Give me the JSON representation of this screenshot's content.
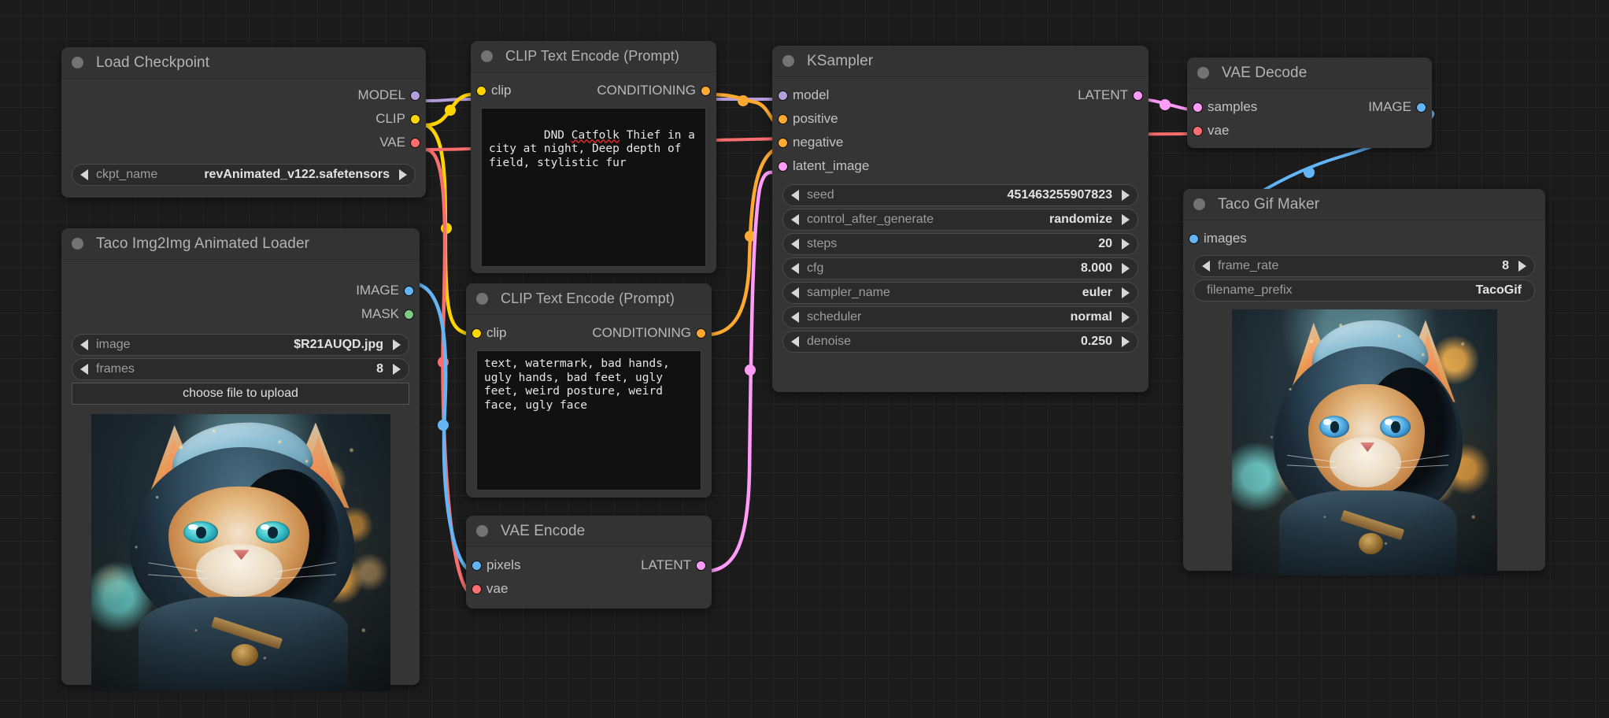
{
  "app": {
    "canvas_background": "#1b1b1b",
    "node_background": "#353535"
  },
  "socket_colors": {
    "MODEL": "#b39ddb",
    "CLIP": "#ffd500",
    "VAE": "#ff6e6e",
    "CONDITIONING": "#ffa931",
    "LATENT": "#ff9cf9",
    "IMAGE": "#64b5f6",
    "MASK": "#81c784"
  },
  "nodes": {
    "load_checkpoint": {
      "title": "Load Checkpoint",
      "outputs": [
        {
          "label": "MODEL",
          "type": "MODEL"
        },
        {
          "label": "CLIP",
          "type": "CLIP"
        },
        {
          "label": "VAE",
          "type": "VAE"
        }
      ],
      "widgets": [
        {
          "name": "ckpt_name",
          "value": "revAnimated_v122.safetensors"
        }
      ]
    },
    "taco_loader": {
      "title": "Taco Img2Img Animated Loader",
      "outputs": [
        {
          "label": "IMAGE",
          "type": "IMAGE"
        },
        {
          "label": "MASK",
          "type": "MASK"
        }
      ],
      "widgets": [
        {
          "name": "image",
          "value": "$R21AUQD.jpg"
        },
        {
          "name": "frames",
          "value": "8"
        }
      ],
      "upload_button": "choose file to upload"
    },
    "clip_positive": {
      "title": "CLIP Text Encode (Prompt)",
      "input": {
        "label": "clip",
        "type": "CLIP"
      },
      "output": {
        "label": "CONDITIONING",
        "type": "CONDITIONING"
      },
      "text_pre": "DND ",
      "text_misspelled": "Catfolk",
      "text_post": " Thief in a city at night, Deep depth of field, stylistic fur"
    },
    "clip_negative": {
      "title": "CLIP Text Encode (Prompt)",
      "input": {
        "label": "clip",
        "type": "CLIP"
      },
      "output": {
        "label": "CONDITIONING",
        "type": "CONDITIONING"
      },
      "text": "text, watermark, bad hands, ugly hands, bad feet, ugly feet, weird posture, weird face, ugly face"
    },
    "vae_encode": {
      "title": "VAE Encode",
      "inputs": [
        {
          "label": "pixels",
          "type": "IMAGE"
        },
        {
          "label": "vae",
          "type": "VAE"
        }
      ],
      "outputs": [
        {
          "label": "LATENT",
          "type": "LATENT"
        }
      ]
    },
    "ksampler": {
      "title": "KSampler",
      "inputs": [
        {
          "label": "model",
          "type": "MODEL"
        },
        {
          "label": "positive",
          "type": "CONDITIONING"
        },
        {
          "label": "negative",
          "type": "CONDITIONING"
        },
        {
          "label": "latent_image",
          "type": "LATENT"
        }
      ],
      "outputs": [
        {
          "label": "LATENT",
          "type": "LATENT"
        }
      ],
      "widgets": [
        {
          "name": "seed",
          "value": "451463255907823"
        },
        {
          "name": "control_after_generate",
          "value": "randomize"
        },
        {
          "name": "steps",
          "value": "20"
        },
        {
          "name": "cfg",
          "value": "8.000"
        },
        {
          "name": "sampler_name",
          "value": "euler"
        },
        {
          "name": "scheduler",
          "value": "normal"
        },
        {
          "name": "denoise",
          "value": "0.250"
        }
      ]
    },
    "vae_decode": {
      "title": "VAE Decode",
      "inputs": [
        {
          "label": "samples",
          "type": "LATENT"
        },
        {
          "label": "vae",
          "type": "VAE"
        }
      ],
      "outputs": [
        {
          "label": "IMAGE",
          "type": "IMAGE"
        }
      ]
    },
    "taco_gif_maker": {
      "title": "Taco Gif Maker",
      "inputs": [
        {
          "label": "images",
          "type": "IMAGE"
        }
      ],
      "widgets": [
        {
          "name": "frame_rate",
          "value": "8"
        },
        {
          "name": "filename_prefix",
          "value": "TacoGif"
        }
      ]
    }
  }
}
